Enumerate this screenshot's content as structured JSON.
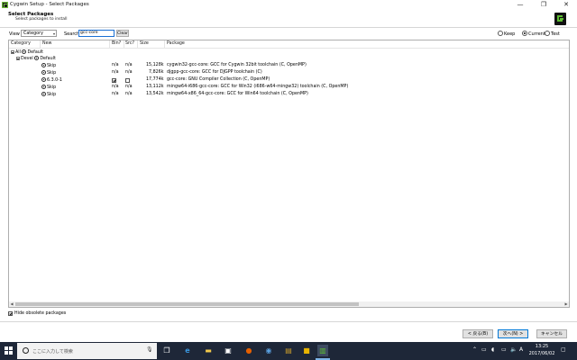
{
  "window": {
    "title": "Cygwin Setup - Select Packages",
    "min": "—",
    "max": "❐",
    "close": "✕"
  },
  "header": {
    "title": "Select Packages",
    "subtitle": "Select packages to install"
  },
  "controls": {
    "view_label": "View",
    "view_value": "Category",
    "search_label": "Search",
    "search_value": "gcc-core",
    "clear_label": "Clear",
    "keep_label": "Keep",
    "current_label": "Current",
    "test_label": "Test",
    "selected_radio": "Current"
  },
  "columns": {
    "category": "Category",
    "new": "New",
    "bin": "Bin?",
    "src": "Src?",
    "size": "Size",
    "package": "Package"
  },
  "tree": {
    "all_label": "All",
    "all_default": "Default",
    "devel_label": "Devel",
    "devel_default": "Default"
  },
  "rows": [
    {
      "new": "Skip",
      "bin": "n/a",
      "src": "n/a",
      "size": "15,128k",
      "package": "cygwin32-gcc-core: GCC for Cygwin 32bit toolchain (C, OpenMP)",
      "bin_checked": false,
      "src_checked": false
    },
    {
      "new": "Skip",
      "bin": "n/a",
      "src": "n/a",
      "size": "7,826k",
      "package": "djgpp-gcc-core: GCC for DJGPP toolchain (C)",
      "bin_checked": false,
      "src_checked": false
    },
    {
      "new": "6.3.0-1",
      "bin": "",
      "src": "",
      "size": "17,774k",
      "package": "gcc-core: GNU Compiler Collection (C, OpenMP)",
      "bin_checked": true,
      "src_checked": false
    },
    {
      "new": "Skip",
      "bin": "n/a",
      "src": "n/a",
      "size": "13,112k",
      "package": "mingw64-i686-gcc-core: GCC for Win32 (i686-w64-mingw32) toolchain (C, OpenMP)",
      "bin_checked": false,
      "src_checked": false
    },
    {
      "new": "Skip",
      "bin": "n/a",
      "src": "n/a",
      "size": "13,542k",
      "package": "mingw64-x86_64-gcc-core: GCC for Win64 toolchain (C, OpenMP)",
      "bin_checked": false,
      "src_checked": false
    }
  ],
  "hide_obsolete": {
    "label": "Hide obsolete packages",
    "checked": true
  },
  "buttons": {
    "back": "< 戻る(B)",
    "next": "次へ(N) >",
    "cancel": "キャンセル"
  },
  "taskbar": {
    "search_placeholder": "ここに入力して検索",
    "time": "13:25",
    "date": "2017/06/02",
    "ime": "A",
    "icons": [
      "task-view-icon",
      "edge-icon",
      "file-explorer-icon",
      "store-icon",
      "firefox-icon",
      "terminal-icon",
      "app-icon",
      "cygwin-setup-icon"
    ]
  },
  "colors": {
    "taskbar_bg": "#1e2738",
    "accent": "#0078d7",
    "cygwin_green": "#5dbb32"
  }
}
